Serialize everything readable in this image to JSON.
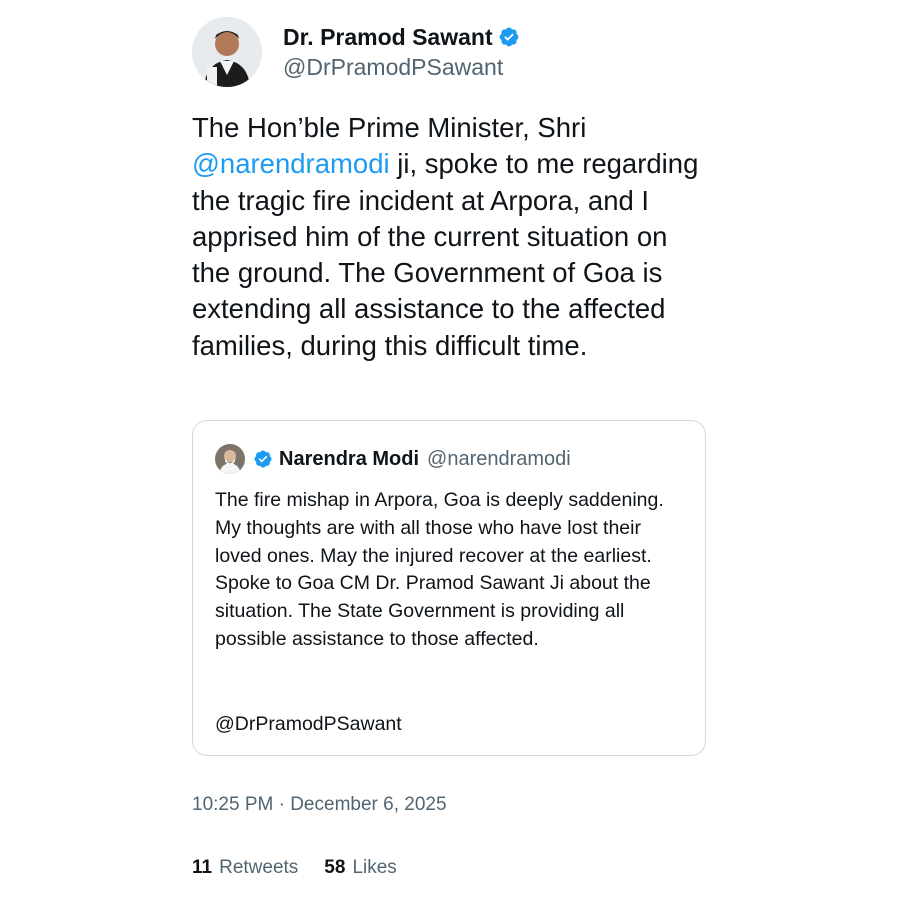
{
  "author": {
    "display_name": "Dr. Pramod Sawant",
    "handle": "@DrPramodPSawant"
  },
  "tweet": {
    "text_before": "The Hon’ble Prime Minister, Shri ",
    "mention": "@narendramodi",
    "text_after": " ji, spoke to me regarding the tragic fire incident at Arpora, and I apprised him of the current situation on the ground. The Government of Goa is extending all assistance to the affected families, during this difficult time."
  },
  "quoted_tweet": {
    "display_name": "Narendra Modi",
    "handle": "@narendramodi",
    "text": "The fire mishap in Arpora, Goa is deeply saddening. My thoughts are with all those who have lost their loved ones. May the injured recover at the earliest. Spoke to Goa CM Dr. Pramod Sawant Ji about the situation. The State Government is providing all possible assistance to those affected.",
    "mention": "@DrPramodPSawant"
  },
  "meta": {
    "timestamp": "10:25 PM · December 6, 2025"
  },
  "stats": {
    "retweets_count": "11",
    "retweets_label": "Retweets",
    "likes_count": "58",
    "likes_label": "Likes"
  },
  "colors": {
    "accent": "#1d9bf0",
    "secondary_text": "#536471",
    "border": "#cfd9de"
  }
}
